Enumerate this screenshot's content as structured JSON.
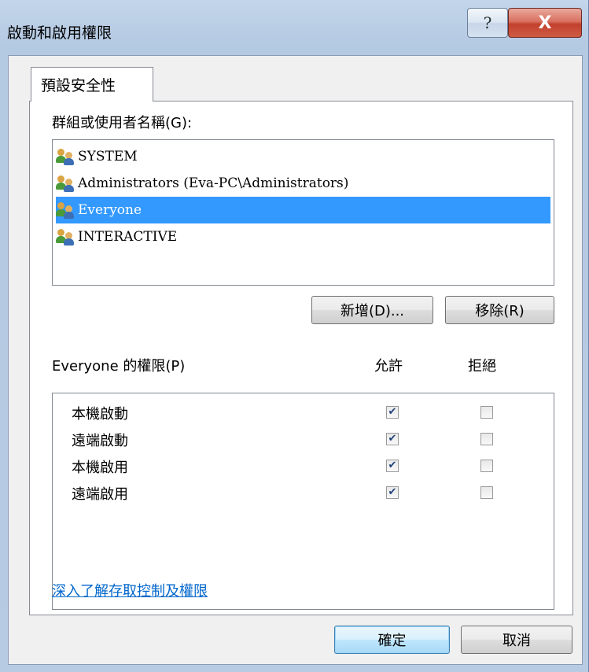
{
  "window": {
    "title": "啟動和啟用權限",
    "help_glyph": "?",
    "close_glyph": "X"
  },
  "tab": {
    "label": "預設安全性"
  },
  "groups": {
    "label": "群組或使用者名稱(G):",
    "items": [
      {
        "name": "SYSTEM",
        "icon": "users-icon",
        "selected": false
      },
      {
        "name": "Administrators (Eva-PC\\Administrators)",
        "icon": "users-icon",
        "selected": false
      },
      {
        "name": "Everyone",
        "icon": "users-icon",
        "selected": true
      },
      {
        "name": "INTERACTIVE",
        "icon": "users-icon",
        "selected": false
      }
    ],
    "add_label": "新增(D)...",
    "remove_label": "移除(R)"
  },
  "permissions": {
    "label": "Everyone 的權限(P)",
    "allow_header": "允許",
    "deny_header": "拒絕",
    "rows": [
      {
        "name": "本機啟動",
        "allow": true,
        "deny": false
      },
      {
        "name": "遠端啟動",
        "allow": true,
        "deny": false
      },
      {
        "name": "本機啟用",
        "allow": true,
        "deny": false
      },
      {
        "name": "遠端啟用",
        "allow": true,
        "deny": false
      }
    ]
  },
  "link_text": "深入了解存取控制及權限",
  "footer": {
    "ok_label": "確定",
    "cancel_label": "取消"
  },
  "colors": {
    "selection": "#3399ff",
    "link": "#0066cc",
    "close_button": "#c2412c",
    "frame": "#b7cbe3"
  }
}
